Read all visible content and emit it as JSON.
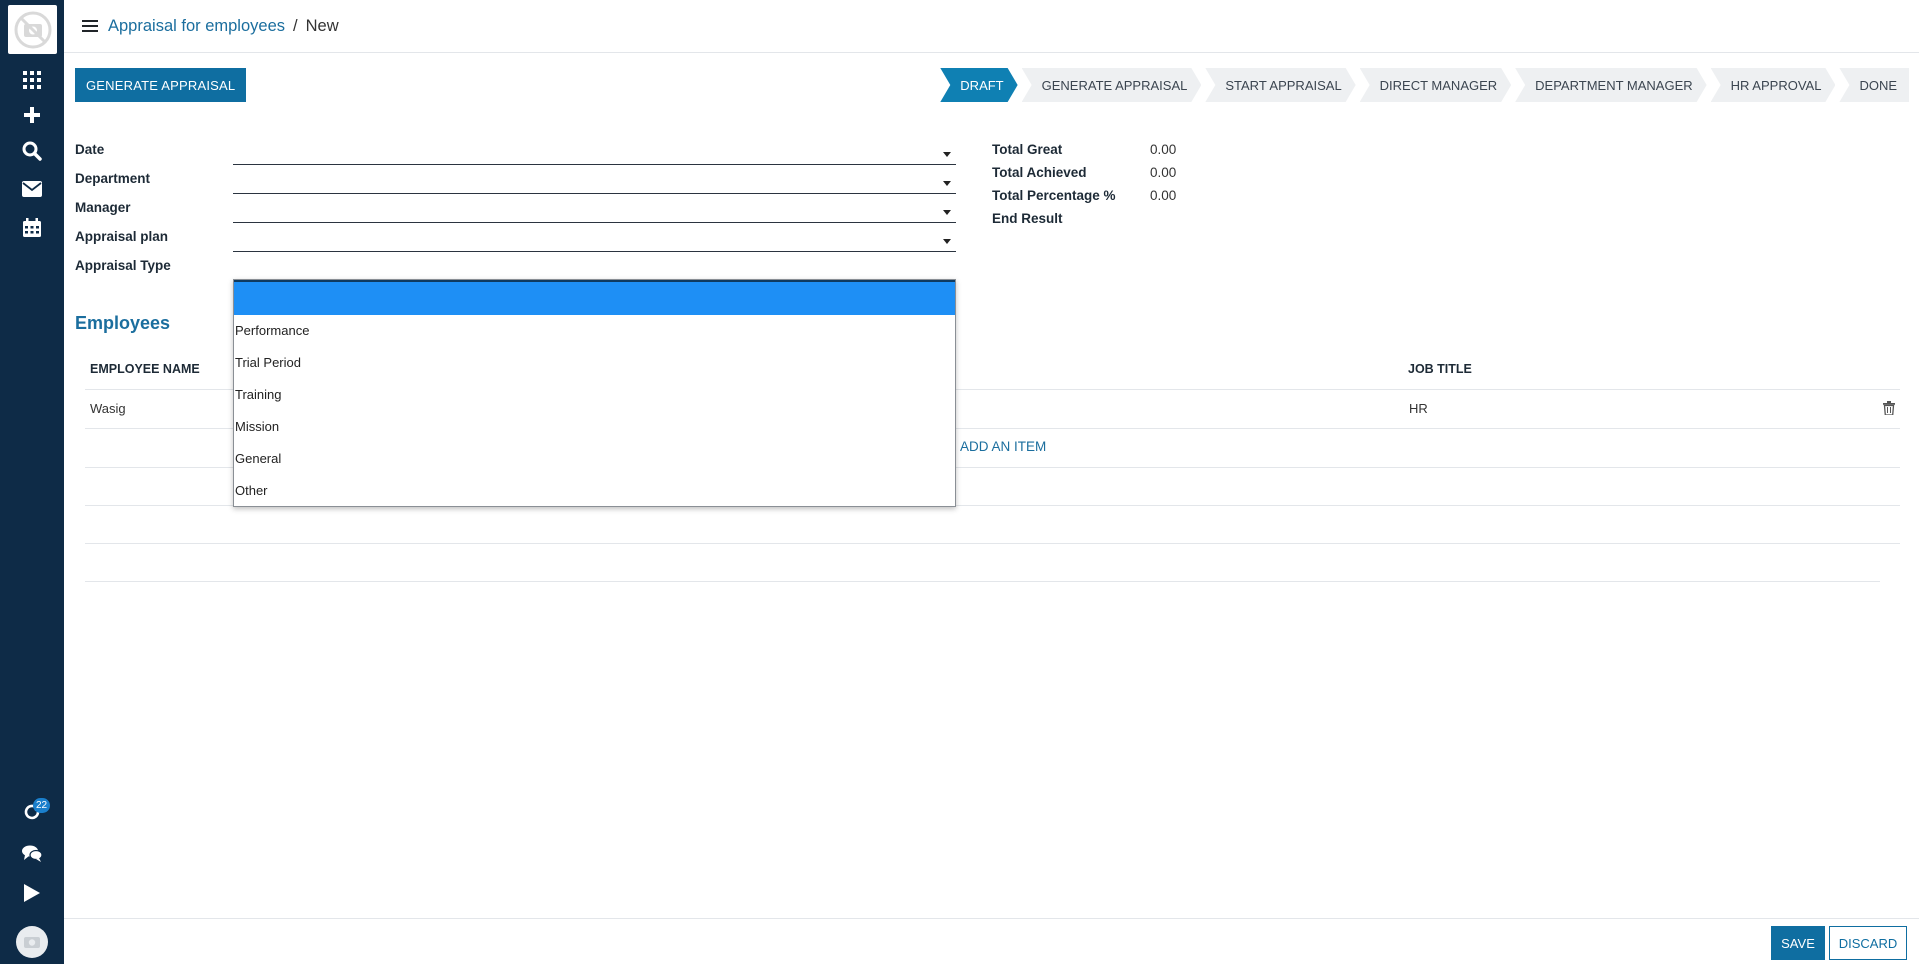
{
  "sidebar": {
    "badge_count": "22",
    "icons": [
      "logo-placeholder-icon",
      "apps-grid-icon",
      "plus-icon",
      "search-icon",
      "envelope-icon",
      "calendar-icon",
      "refresh-icon",
      "chat-icon",
      "play-icon",
      "avatar-icon"
    ]
  },
  "breadcrumb": {
    "parent": "Appraisal for employees",
    "separator": "/",
    "current": "New"
  },
  "header": {
    "generate_button": "GENERATE APPRAISAL",
    "stages": [
      {
        "label": "DRAFT",
        "active": true
      },
      {
        "label": "GENERATE APPRAISAL",
        "active": false
      },
      {
        "label": "START APPRAISAL",
        "active": false
      },
      {
        "label": "DIRECT MANAGER",
        "active": false
      },
      {
        "label": "DEPARTMENT MANAGER",
        "active": false
      },
      {
        "label": "HR APPROVAL",
        "active": false
      },
      {
        "label": "DONE",
        "active": false
      }
    ]
  },
  "form": {
    "fields": [
      {
        "label": "Date",
        "value": ""
      },
      {
        "label": "Department",
        "value": ""
      },
      {
        "label": "Manager",
        "value": ""
      },
      {
        "label": "Appraisal plan",
        "value": ""
      },
      {
        "label": "Appraisal Type",
        "value": ""
      }
    ],
    "totals": [
      {
        "label": "Total Great",
        "value": "0.00"
      },
      {
        "label": "Total Achieved",
        "value": "0.00"
      },
      {
        "label": "Total Percentage %",
        "value": "0.00"
      },
      {
        "label": "End Result",
        "value": ""
      }
    ]
  },
  "employees": {
    "title": "Employees",
    "columns": [
      "EMPLOYEE NAME",
      "JOB TITLE"
    ],
    "rows": [
      {
        "name": "Wasig",
        "job_title": "HR"
      }
    ],
    "add_item": "ADD AN ITEM"
  },
  "dropdown": {
    "selected": "",
    "options": [
      "Performance",
      "Trial Period",
      "Training",
      "Mission",
      "General",
      "Other"
    ]
  },
  "footer": {
    "save": "SAVE",
    "discard": "DISCARD"
  },
  "colors": {
    "sidebar": "#0e2b47",
    "primary": "#0f6ea1",
    "link": "#1b6e9e",
    "dropdown_highlight": "#1e8ff5"
  }
}
